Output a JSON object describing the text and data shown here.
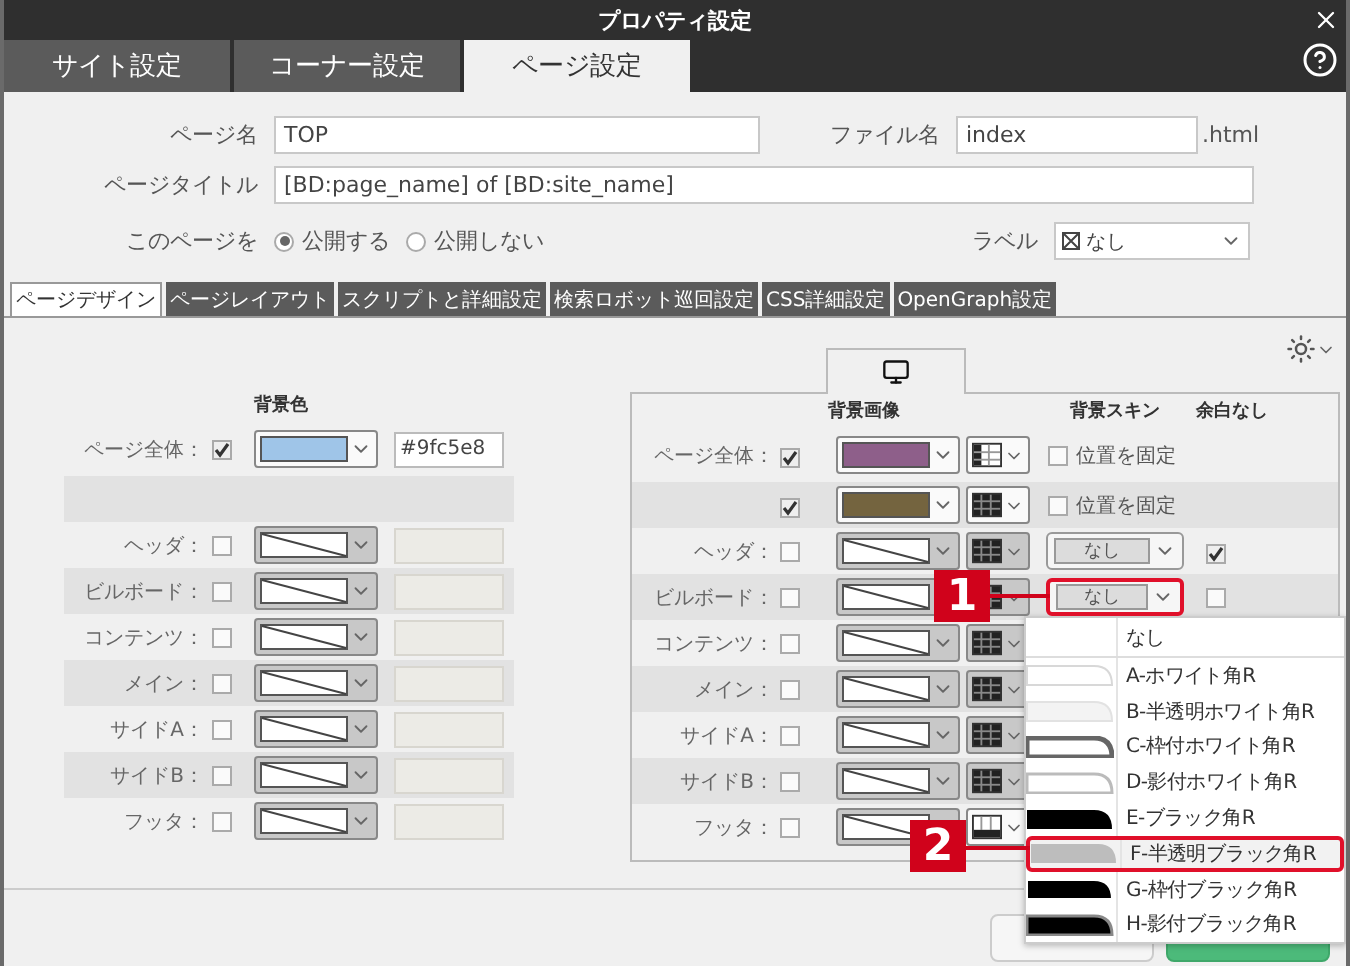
{
  "window": {
    "title": "プロパティ設定"
  },
  "tabs": [
    {
      "label": "サイト設定",
      "selected": false
    },
    {
      "label": "コーナー設定",
      "selected": false
    },
    {
      "label": "ページ設定",
      "selected": true
    }
  ],
  "page_name": {
    "label": "ページ名",
    "value": "TOP"
  },
  "file_name": {
    "label": "ファイル名",
    "value": "index",
    "suffix": ".html"
  },
  "page_title": {
    "label": "ページタイトル",
    "value": "[BD:page_name] of [BD:site_name]"
  },
  "publish": {
    "label": "このページを",
    "options": [
      {
        "label": "公開する",
        "selected": true
      },
      {
        "label": "公開しない",
        "selected": false
      }
    ]
  },
  "label_select": {
    "label": "ラベル",
    "value": "なし"
  },
  "subtabs": [
    {
      "label": "ページデザイン",
      "selected": true
    },
    {
      "label": "ページレイアウト",
      "selected": false
    },
    {
      "label": "スクリプトと詳細設定",
      "selected": false
    },
    {
      "label": "検索ロボット巡回設定",
      "selected": false
    },
    {
      "label": "CSS詳細設定",
      "selected": false
    },
    {
      "label": "OpenGraph設定",
      "selected": false
    }
  ],
  "background_color": {
    "header": "背景色",
    "rows": [
      {
        "kind": "item",
        "label": "ページ全体：",
        "checked": true,
        "color": "#9fc5e8",
        "value": "#9fc5e8"
      },
      {
        "kind": "blank"
      },
      {
        "kind": "item",
        "label": "ヘッダ：",
        "checked": false
      },
      {
        "kind": "item",
        "label": "ビルボード：",
        "checked": false
      },
      {
        "kind": "item",
        "label": "コンテンツ：",
        "checked": false
      },
      {
        "kind": "item",
        "label": "メイン：",
        "checked": false
      },
      {
        "kind": "item",
        "label": "サイドA：",
        "checked": false
      },
      {
        "kind": "item",
        "label": "サイドB：",
        "checked": false
      },
      {
        "kind": "item",
        "label": "フッタ：",
        "checked": false
      }
    ]
  },
  "background_image": {
    "headers": [
      "背景画像",
      "背景スキン",
      "余白なし"
    ],
    "rows": [
      {
        "label": "ページ全体：",
        "checked": true,
        "color": "#8e5f8a",
        "pattern": {
          "kind": "columns"
        },
        "skin": {
          "kind": "fixed",
          "label": "位置を固定",
          "checked": false
        }
      },
      {
        "checked": true,
        "color": "#74643f",
        "pattern": {
          "kind": "grid"
        },
        "skin": {
          "kind": "fixed",
          "label": "位置を固定",
          "checked": false
        }
      },
      {
        "label": "ヘッダ：",
        "checked": false,
        "pattern": {
          "kind": "grid"
        },
        "skin": {
          "kind": "select",
          "value": "なし",
          "open": false
        },
        "no_margin": true
      },
      {
        "label": "ビルボード：",
        "checked": false,
        "pattern": {
          "kind": "grid"
        },
        "skin": {
          "kind": "select",
          "value": "なし",
          "open": true
        },
        "no_margin": false
      },
      {
        "label": "コンテンツ：",
        "checked": false,
        "pattern": {
          "kind": "grid"
        }
      },
      {
        "label": "メイン：",
        "checked": false,
        "pattern": {
          "kind": "grid"
        }
      },
      {
        "label": "サイドA：",
        "checked": false,
        "pattern": {
          "kind": "grid"
        }
      },
      {
        "label": "サイドB：",
        "checked": false,
        "pattern": {
          "kind": "grid"
        }
      },
      {
        "label": "フッタ：",
        "checked": false,
        "pattern": {
          "kind": "footer"
        }
      }
    ],
    "skin_options": [
      {
        "label": "なし",
        "kind": "none",
        "selected": false
      },
      {
        "label": "A-ホワイト角R",
        "kind": "white",
        "selected": false
      },
      {
        "label": "B-半透明ホワイト角R",
        "kind": "translucent-white",
        "selected": false
      },
      {
        "label": "C-枠付ホワイト角R",
        "kind": "framed-white",
        "selected": false
      },
      {
        "label": "D-影付ホワイト角R",
        "kind": "shadow-white",
        "selected": false
      },
      {
        "label": "E-ブラック角R",
        "kind": "black",
        "selected": false
      },
      {
        "label": "F-半透明ブラック角R",
        "kind": "translucent-black",
        "selected": true
      },
      {
        "label": "G-枠付ブラック角R",
        "kind": "framed-black",
        "selected": false
      },
      {
        "label": "H-影付ブラック角R",
        "kind": "shadow-black",
        "selected": false
      }
    ]
  },
  "callouts": [
    {
      "label": "1"
    },
    {
      "label": "2"
    }
  ]
}
